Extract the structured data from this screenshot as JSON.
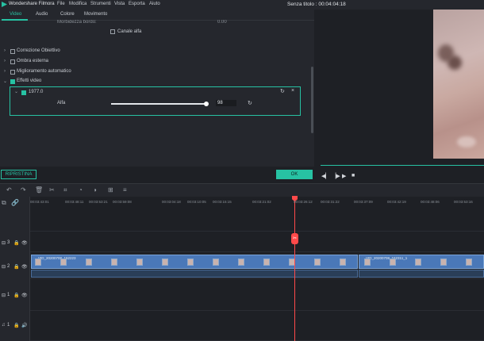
{
  "app": {
    "name": "Wondershare Filmora",
    "menu": [
      "File",
      "Modifica",
      "Strumenti",
      "Vista",
      "Esporta",
      "Aiuto"
    ],
    "document_title": "Senza titolo : 00:04:04:18"
  },
  "tabs": [
    "Video",
    "Audio",
    "Colore",
    "Movimento"
  ],
  "panel": {
    "cut_top_label": "Morbidezza bordo:",
    "cut_top_value": "0.00",
    "alpha_channel_label": "Canale alfa",
    "sections": [
      "Correzione Obiettivo",
      "Ombra esterna",
      "Miglioramento automatico",
      "Effetti video"
    ],
    "effect_name": "1977.0",
    "alpha_label": "Alfa",
    "alpha_value": "98",
    "alpha_fraction": 0.98,
    "reset_label": "RIPRISTINA",
    "ok_label": "OK"
  },
  "ruler": [
    "00:03:43:01",
    "00:03:48:11",
    "00:03:53:21",
    "00:03:59:08",
    "00:03:04:18",
    "00:03:10:05",
    "00:03:15:15",
    "00:03:21:02",
    "00:03:26:12",
    "00:03:31:22",
    "00:03:37:09",
    "00:03:42:19",
    "00:03:48:06",
    "00:03:53:16"
  ],
  "tracks": {
    "track3_label": "3",
    "track2_label": "2",
    "track1_label": "1",
    "audio1_label": "1"
  },
  "clips": {
    "clip1_name": "VID_20200708_162223",
    "clip2_name": "VID_20200708_162311_1"
  },
  "colors": {
    "accent": "#27c2a3",
    "playhead": "#ff4a4a",
    "clip": "#4a78b8"
  }
}
